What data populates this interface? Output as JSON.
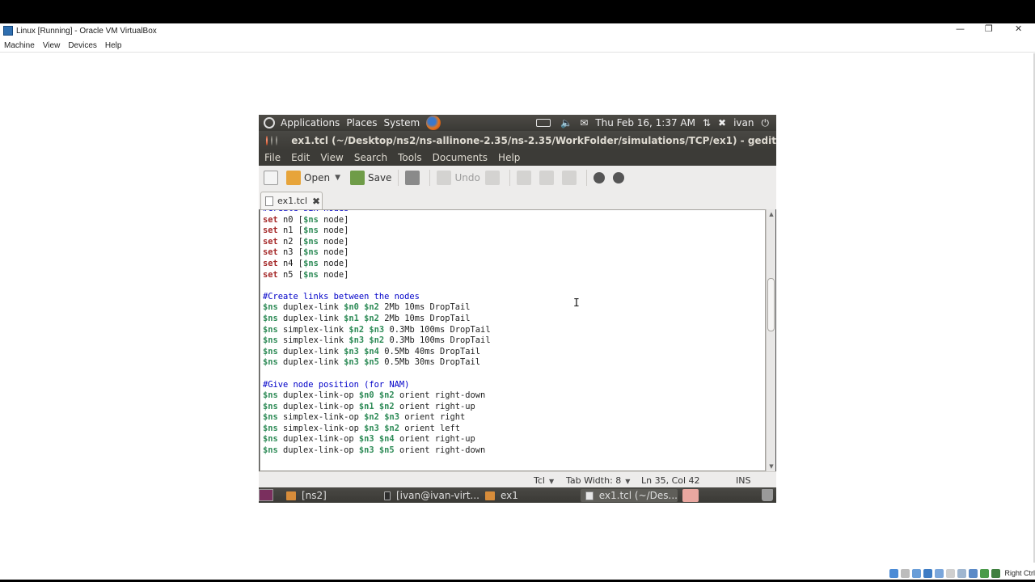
{
  "host": {
    "title": "Linux [Running] - Oracle VM VirtualBox",
    "menu": [
      "Machine",
      "View",
      "Devices",
      "Help"
    ],
    "window_controls": {
      "minimize": "—",
      "restore": "❐",
      "close": "✕"
    },
    "status_right": "Right Ctrl"
  },
  "top_panel": {
    "menus": [
      "Applications",
      "Places",
      "System"
    ],
    "datetime": "Thu Feb 16, 1:37 AM",
    "user": "ivan"
  },
  "window": {
    "title": "ex1.tcl (~/Desktop/ns2/ns-allinone-2.35/ns-2.35/WorkFolder/simulations/TCP/ex1) - gedit"
  },
  "menubar": [
    "File",
    "Edit",
    "View",
    "Search",
    "Tools",
    "Documents",
    "Help"
  ],
  "toolbar": {
    "open_label": "Open",
    "save_label": "Save",
    "undo_label": "Undo"
  },
  "tab": {
    "label": "ex1.tcl"
  },
  "code_lines": [
    [
      {
        "t": "#Create six nodes",
        "c": "cm"
      }
    ],
    [
      {
        "t": "set",
        "c": "kw"
      },
      {
        "t": " n0 ["
      },
      {
        "t": "$ns",
        "c": "var"
      },
      {
        "t": " node]"
      }
    ],
    [
      {
        "t": "set",
        "c": "kw"
      },
      {
        "t": " n1 ["
      },
      {
        "t": "$ns",
        "c": "var"
      },
      {
        "t": " node]"
      }
    ],
    [
      {
        "t": "set",
        "c": "kw"
      },
      {
        "t": " n2 ["
      },
      {
        "t": "$ns",
        "c": "var"
      },
      {
        "t": " node]"
      }
    ],
    [
      {
        "t": "set",
        "c": "kw"
      },
      {
        "t": " n3 ["
      },
      {
        "t": "$ns",
        "c": "var"
      },
      {
        "t": " node]"
      }
    ],
    [
      {
        "t": "set",
        "c": "kw"
      },
      {
        "t": " n4 ["
      },
      {
        "t": "$ns",
        "c": "var"
      },
      {
        "t": " node]"
      }
    ],
    [
      {
        "t": "set",
        "c": "kw"
      },
      {
        "t": " n5 ["
      },
      {
        "t": "$ns",
        "c": "var"
      },
      {
        "t": " node]"
      }
    ],
    [],
    [
      {
        "t": "#Create links between the nodes",
        "c": "cm"
      }
    ],
    [
      {
        "t": "$ns",
        "c": "var"
      },
      {
        "t": " duplex-link "
      },
      {
        "t": "$n0",
        "c": "var"
      },
      {
        "t": " "
      },
      {
        "t": "$n2",
        "c": "var"
      },
      {
        "t": " 2Mb 10ms DropTail"
      }
    ],
    [
      {
        "t": "$ns",
        "c": "var"
      },
      {
        "t": " duplex-link "
      },
      {
        "t": "$n1",
        "c": "var"
      },
      {
        "t": " "
      },
      {
        "t": "$n2",
        "c": "var"
      },
      {
        "t": " 2Mb 10ms DropTail"
      }
    ],
    [
      {
        "t": "$ns",
        "c": "var"
      },
      {
        "t": " simplex-link "
      },
      {
        "t": "$n2",
        "c": "var"
      },
      {
        "t": " "
      },
      {
        "t": "$n3",
        "c": "var"
      },
      {
        "t": " 0.3Mb 100ms DropTail"
      }
    ],
    [
      {
        "t": "$ns",
        "c": "var"
      },
      {
        "t": " simplex-link "
      },
      {
        "t": "$n3",
        "c": "var"
      },
      {
        "t": " "
      },
      {
        "t": "$n2",
        "c": "var"
      },
      {
        "t": " 0.3Mb 100ms DropTail"
      }
    ],
    [
      {
        "t": "$ns",
        "c": "var"
      },
      {
        "t": " duplex-link "
      },
      {
        "t": "$n3",
        "c": "var"
      },
      {
        "t": " "
      },
      {
        "t": "$n4",
        "c": "var"
      },
      {
        "t": " 0.5Mb 40ms DropTail"
      }
    ],
    [
      {
        "t": "$ns",
        "c": "var"
      },
      {
        "t": " duplex-link "
      },
      {
        "t": "$n3",
        "c": "var"
      },
      {
        "t": " "
      },
      {
        "t": "$n5",
        "c": "var"
      },
      {
        "t": " 0.5Mb 30ms DropTail"
      }
    ],
    [],
    [
      {
        "t": "#Give node position (for NAM)",
        "c": "cm"
      }
    ],
    [
      {
        "t": "$ns",
        "c": "var"
      },
      {
        "t": " duplex-link-op "
      },
      {
        "t": "$n0",
        "c": "var"
      },
      {
        "t": " "
      },
      {
        "t": "$n2",
        "c": "var"
      },
      {
        "t": " orient right-down"
      }
    ],
    [
      {
        "t": "$ns",
        "c": "var"
      },
      {
        "t": " duplex-link-op "
      },
      {
        "t": "$n1",
        "c": "var"
      },
      {
        "t": " "
      },
      {
        "t": "$n2",
        "c": "var"
      },
      {
        "t": " orient right-up"
      }
    ],
    [
      {
        "t": "$ns",
        "c": "var"
      },
      {
        "t": " simplex-link-op "
      },
      {
        "t": "$n2",
        "c": "var"
      },
      {
        "t": " "
      },
      {
        "t": "$n3",
        "c": "var"
      },
      {
        "t": " orient right"
      }
    ],
    [
      {
        "t": "$ns",
        "c": "var"
      },
      {
        "t": " simplex-link-op "
      },
      {
        "t": "$n3",
        "c": "var"
      },
      {
        "t": " "
      },
      {
        "t": "$n2",
        "c": "var"
      },
      {
        "t": " orient left"
      }
    ],
    [
      {
        "t": "$ns",
        "c": "var"
      },
      {
        "t": " duplex-link-op "
      },
      {
        "t": "$n3",
        "c": "var"
      },
      {
        "t": " "
      },
      {
        "t": "$n4",
        "c": "var"
      },
      {
        "t": " orient right-up"
      }
    ],
    [
      {
        "t": "$ns",
        "c": "var"
      },
      {
        "t": " duplex-link-op "
      },
      {
        "t": "$n3",
        "c": "var"
      },
      {
        "t": " "
      },
      {
        "t": "$n5",
        "c": "var"
      },
      {
        "t": " orient right-down"
      }
    ]
  ],
  "statusbar": {
    "language": "Tcl",
    "tab_width": "Tab Width: 8",
    "position": "Ln 35, Col 42",
    "mode": "INS"
  },
  "taskbar": [
    {
      "label": "[ns2]",
      "icon": "folder-icon"
    },
    {
      "label": "[ivan@ivan-virt...",
      "icon": "terminal-icon"
    },
    {
      "label": "ex1",
      "icon": "folder-icon"
    },
    {
      "label": "ex1.tcl (~/Des...",
      "icon": "gedit-icon"
    }
  ],
  "colors": {
    "keyword": "#a52a2a",
    "variable": "#2e8b57",
    "comment": "#0000c8",
    "panel": "#3c3b37"
  }
}
